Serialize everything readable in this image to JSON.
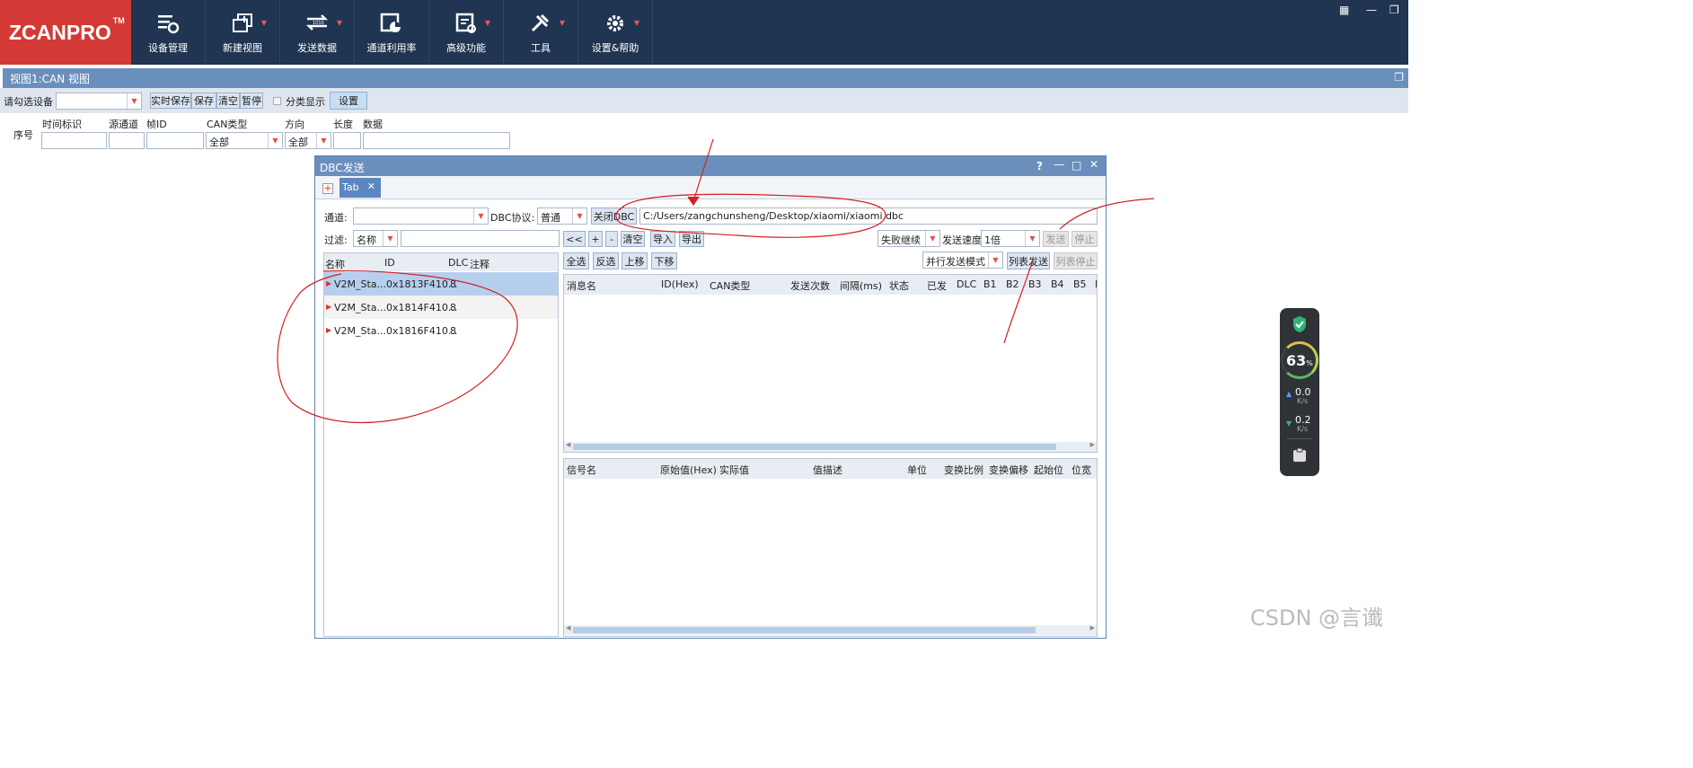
{
  "app": {
    "logo": "ZCANPRO",
    "tm": "TM"
  },
  "toolbar": [
    {
      "label": "设备管理",
      "icon": "device-manage-icon",
      "dropdown": false
    },
    {
      "label": "新建视图",
      "icon": "new-view-icon",
      "dropdown": true
    },
    {
      "label": "发送数据",
      "icon": "send-data-icon",
      "dropdown": true
    },
    {
      "label": "通道利用率",
      "icon": "channel-usage-icon",
      "dropdown": false
    },
    {
      "label": "高级功能",
      "icon": "advanced-icon",
      "dropdown": true
    },
    {
      "label": "工具",
      "icon": "tools-icon",
      "dropdown": true
    },
    {
      "label": "设置&帮助",
      "icon": "settings-icon",
      "dropdown": true
    }
  ],
  "view": {
    "title": "视图1:CAN 视图",
    "select_device_label": "请勾选设备",
    "device_value": "",
    "realtime_save": "实时保存",
    "save": "保存",
    "clear": "清空",
    "pause": "暂停",
    "classify_label": "分类显示",
    "settings_btn": "设置",
    "cols": {
      "seq": "序号",
      "timestamp": "时间标识",
      "src_channel": "源通道",
      "frame_id": "帧ID",
      "can_type": "CAN类型",
      "direction": "方向",
      "length": "长度",
      "data": "数据"
    },
    "filters": {
      "can_type": "全部",
      "direction": "全部"
    }
  },
  "dbc": {
    "title": "DBC发送",
    "help": "?",
    "tab_label": "Tab",
    "channel_label": "通道:",
    "channel_value": "",
    "protocol_label": "DBC协议:",
    "protocol_value": "普通",
    "close_dbc": "关闭DBC",
    "path": "C:/Users/zangchunsheng/Desktop/xiaomi/xiaomi.dbc",
    "filter_label": "过滤:",
    "filter_field": "名称",
    "filter_value": "",
    "btn_prev": "<<",
    "btn_plus": "+",
    "btn_minus": "-",
    "btn_clear": "清空",
    "btn_import": "导入",
    "btn_export": "导出",
    "fail_mode": "失败继续",
    "speed_label": "发送速度",
    "speed_value": "1倍",
    "btn_send": "发送",
    "btn_stop": "停止",
    "btn_select_all": "全选",
    "btn_invert": "反选",
    "btn_up": "上移",
    "btn_down": "下移",
    "parallel_mode": "并行发送模式",
    "btn_list_send": "列表发送",
    "btn_list_stop": "列表停止",
    "left_cols": {
      "name": "名称",
      "id": "ID",
      "dlc": "DLC",
      "note": "注释"
    },
    "messages": [
      {
        "name": "V2M_Sta...",
        "id": "0x1813F410...",
        "dlc": "8"
      },
      {
        "name": "V2M_Sta...",
        "id": "0x1814F410...",
        "dlc": "8"
      },
      {
        "name": "V2M_Sta...",
        "id": "0x1816F410...",
        "dlc": "8"
      }
    ],
    "msg_cols": {
      "name": "消息名",
      "id": "ID(Hex)",
      "can_type": "CAN类型",
      "send_count": "发送次数",
      "interval": "间隔(ms)",
      "status": "状态",
      "sent": "已发",
      "dlc": "DLC",
      "b1": "B1",
      "b2": "B2",
      "b3": "B3",
      "b4": "B4",
      "b5": "B5",
      "b6": "B"
    },
    "sig_cols": {
      "name": "信号名",
      "raw": "原始值(Hex)",
      "actual": "实际值",
      "desc": "值描述",
      "unit": "单位",
      "factor": "变换比例",
      "offset": "变换偏移",
      "start": "起始位",
      "width": "位宽"
    }
  },
  "monitor": {
    "percent": "63",
    "percent_unit": "%",
    "up_value": "0.0",
    "up_unit": "K/s",
    "down_value": "0.2",
    "down_unit": "K/s"
  },
  "watermark": "CSDN @言谶",
  "colors": {
    "topbar": "#1f3551",
    "logo_bg": "#d33a35",
    "title_bar": "#6a8fbd",
    "annotation": "#d42020"
  }
}
